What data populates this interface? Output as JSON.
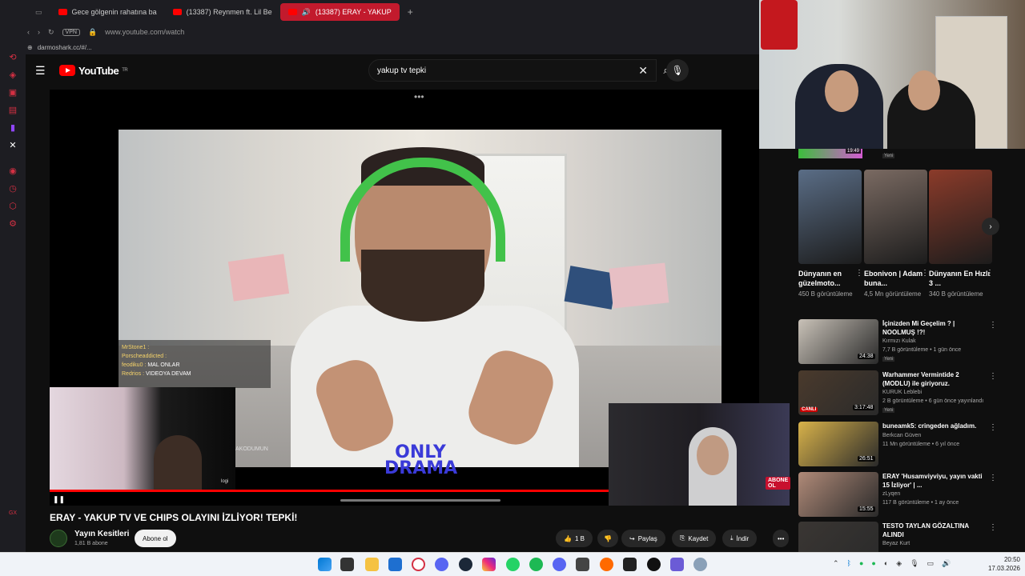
{
  "browser": {
    "tabs": [
      {
        "label": "Gece gölgenin rahatına ba",
        "active": false
      },
      {
        "label": "(13387) Reynmen ft. Lil Be",
        "active": false
      },
      {
        "label": "(13387) ERAY - YAKUP",
        "active": true
      }
    ],
    "vpn_label": "VPN",
    "url": "www.youtube.com/watch",
    "bookmark": "darmoshark.cc/#/..."
  },
  "youtube": {
    "logo_text": "YouTube",
    "region": "TR",
    "search_value": "yakup tv tepki"
  },
  "player": {
    "chat_lines": [
      {
        "user": "MrStone1 :",
        "text": ""
      },
      {
        "user": "Porscheaddicted :",
        "text": ""
      },
      {
        "user": "feodiku0 :",
        "text": "MAL ONLAR"
      },
      {
        "user": "Redrios :",
        "text": "VIDEOYA DEVAM"
      }
    ],
    "overlay_logo": "ONLY DRAMA",
    "overlay_sub": "AKODUMUN",
    "cam_label": "logi",
    "live_badge": "ABONE OL",
    "progress": 1.0
  },
  "video": {
    "title": "ERAY - YAKUP TV VE CHIPS OLAYINI İZLİYOR! TEPKİ!",
    "channel": "Yayın Kesitleri",
    "subscribers": "1,81 B abone",
    "subscribe_label": "Abone ol",
    "likes": "1 B",
    "share_label": "Paylaş",
    "save_label": "Kaydet",
    "download_label": "İndir"
  },
  "recommendations": {
    "top_duration": "19:49",
    "top_badge": "Yeni",
    "shorts": [
      {
        "title": "Dünyanın en güzelmoto...",
        "views": "450 B görüntüleme",
        "color": "#5a6d86"
      },
      {
        "title": "Ebonivon | Adam buna...",
        "views": "4,5 Mn görüntüleme",
        "color": "#7a6a62"
      },
      {
        "title": "Dünyanın En Hızlı 3 ...",
        "views": "340 B görüntüleme",
        "color": "#8b3b2a"
      }
    ],
    "videos": [
      {
        "title": "İçinizden Mi Geçelim ? | NOOLMUŞ !?!",
        "channel": "Kırmızı Kulak",
        "meta": "7,7 B görüntüleme • 1 gün önce",
        "badge": "Yeni",
        "duration": "24:38",
        "live": "",
        "color": "#c9c2b8"
      },
      {
        "title": "Warhammer Vermintide 2 (MODLU) ile giriyoruz.",
        "channel": "KURUK Leblebi",
        "meta": "2 B görüntüleme • 6 gün önce yayınlandı",
        "badge": "Yeni",
        "duration": "3:17:48",
        "live": "CANLI",
        "color": "#4a3a2c"
      },
      {
        "title": "buneamk5: cringeden ağladım.",
        "channel": "Berkcan Güven",
        "meta": "11 Mn görüntüleme • 6 yıl önce",
        "badge": "",
        "duration": "26:51",
        "live": "",
        "color": "#d8b24a"
      },
      {
        "title": "ERAY 'Husamviyviyu, yayın vakti 15 İzliyor' | ...",
        "channel": "zLyqen",
        "meta": "117 B görüntüleme • 1 ay önce",
        "badge": "",
        "duration": "15:55",
        "live": "",
        "color": "#b08a78"
      },
      {
        "title": "TESTO TAYLAN GÖZALTINA ALINDI",
        "channel": "Beyaz Kurt",
        "meta": "",
        "badge": "",
        "duration": "",
        "live": "",
        "color": "#3a3633"
      }
    ]
  },
  "taskbar": {
    "time": "20:50",
    "date": "17.03.2026"
  }
}
